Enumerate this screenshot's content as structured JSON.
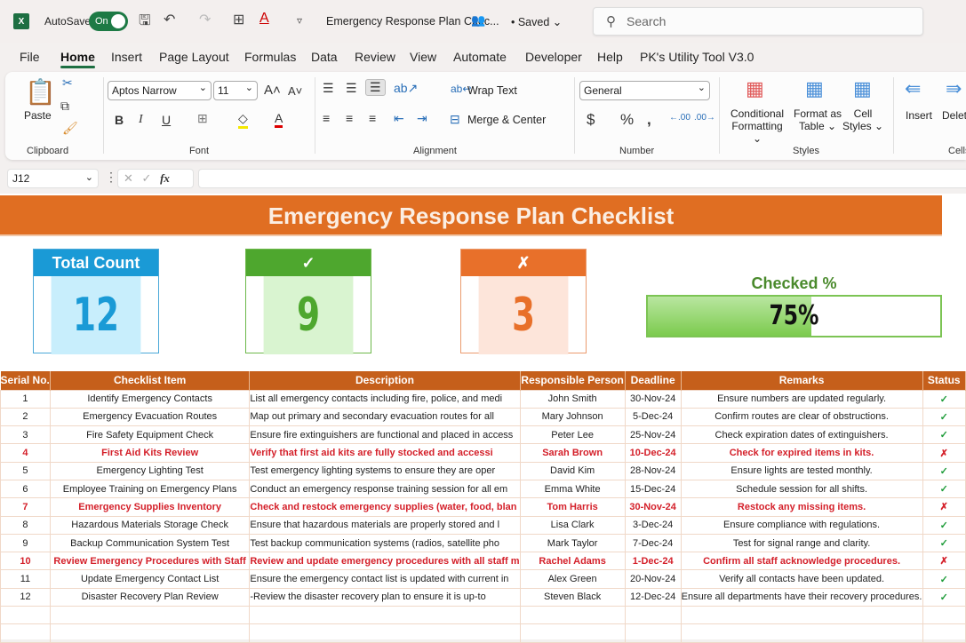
{
  "titlebar": {
    "autosave_label": "AutoSave",
    "autosave_state": "On",
    "doc_title": "Emergency Response Plan Chec...",
    "saved_status": "• Saved ⌄",
    "search_placeholder": "Search"
  },
  "tabs": [
    "File",
    "Home",
    "Insert",
    "Page Layout",
    "Formulas",
    "Data",
    "Review",
    "View",
    "Automate",
    "Developer",
    "Help",
    "PK's Utility Tool V3.0"
  ],
  "active_tab": "Home",
  "ribbon": {
    "clipboard": {
      "paste": "Paste",
      "label": "Clipboard"
    },
    "font": {
      "name": "Aptos Narrow",
      "size": "11",
      "label": "Font",
      "bold": "B",
      "italic": "I",
      "underline": "U"
    },
    "alignment": {
      "wrap_text": "Wrap Text",
      "merge_center": "Merge & Center",
      "label": "Alignment"
    },
    "number": {
      "format": "General",
      "label": "Number"
    },
    "styles": {
      "conditional": "Conditional",
      "conditional2": "Formatting ⌄",
      "format_as": "Format as",
      "format_as2": "Table ⌄",
      "cell": "Cell",
      "cell2": "Styles ⌄",
      "label": "Styles"
    },
    "cells": {
      "insert": "Insert",
      "delete": "Delete",
      "label": "Cells"
    }
  },
  "formula_bar": {
    "name_box": "J12",
    "fx": "fx",
    "value": ""
  },
  "sheet": {
    "title": "Emergency Response Plan Checklist",
    "cards": {
      "total": {
        "header": "Total Count",
        "value": "12",
        "color": "#1a9ad6"
      },
      "checked": {
        "header": "✓",
        "value": "9",
        "color": "#4ea72e"
      },
      "unchecked": {
        "header": "✗",
        "value": "3",
        "color": "#e8702a"
      }
    },
    "checked_pct": {
      "label": "Checked %",
      "value": 0.75,
      "text": "75%"
    },
    "columns": [
      "Serial No.",
      "Checklist Item",
      "Description",
      "Responsible Person",
      "Deadline",
      "Remarks",
      "Status"
    ],
    "rows": [
      {
        "no": "1",
        "item": "Identify Emergency Contacts",
        "desc": "List all emergency contacts including fire, police, and medi",
        "person": "John Smith",
        "deadline": "30-Nov-24",
        "remarks": "Ensure numbers are updated regularly.",
        "status": "✓",
        "flag": false
      },
      {
        "no": "2",
        "item": "Emergency Evacuation Routes",
        "desc": "Map out primary and secondary evacuation routes for all",
        "person": "Mary Johnson",
        "deadline": "5-Dec-24",
        "remarks": "Confirm routes are clear of obstructions.",
        "status": "✓",
        "flag": false
      },
      {
        "no": "3",
        "item": "Fire Safety Equipment Check",
        "desc": "Ensure fire extinguishers are functional and placed in access",
        "person": "Peter Lee",
        "deadline": "25-Nov-24",
        "remarks": "Check expiration dates of extinguishers.",
        "status": "✓",
        "flag": false
      },
      {
        "no": "4",
        "item": "First Aid Kits Review",
        "desc": "Verify that first aid kits are fully stocked and accessi",
        "person": "Sarah Brown",
        "deadline": "10-Dec-24",
        "remarks": "Check for expired items in kits.",
        "status": "✗",
        "flag": true
      },
      {
        "no": "5",
        "item": "Emergency Lighting Test",
        "desc": "Test emergency lighting systems to ensure they are oper",
        "person": "David Kim",
        "deadline": "28-Nov-24",
        "remarks": "Ensure lights are tested monthly.",
        "status": "✓",
        "flag": false
      },
      {
        "no": "6",
        "item": "Employee Training on Emergency Plans",
        "desc": "Conduct an emergency response training session for all em",
        "person": "Emma White",
        "deadline": "15-Dec-24",
        "remarks": "Schedule session for all shifts.",
        "status": "✓",
        "flag": false
      },
      {
        "no": "7",
        "item": "Emergency Supplies Inventory",
        "desc": "Check and restock emergency supplies (water, food, blan",
        "person": "Tom Harris",
        "deadline": "30-Nov-24",
        "remarks": "Restock any missing items.",
        "status": "✗",
        "flag": true
      },
      {
        "no": "8",
        "item": "Hazardous Materials Storage Check",
        "desc": "Ensure that hazardous materials are properly stored and l",
        "person": "Lisa Clark",
        "deadline": "3-Dec-24",
        "remarks": "Ensure compliance with regulations.",
        "status": "✓",
        "flag": false
      },
      {
        "no": "9",
        "item": "Backup Communication System Test",
        "desc": "Test backup communication systems (radios, satellite pho",
        "person": "Mark Taylor",
        "deadline": "7-Dec-24",
        "remarks": "Test for signal range and clarity.",
        "status": "✓",
        "flag": false
      },
      {
        "no": "10",
        "item": "Review Emergency Procedures with Staff",
        "desc": "Review and update emergency procedures with all staff m",
        "person": "Rachel Adams",
        "deadline": "1-Dec-24",
        "remarks": "Confirm all staff acknowledge procedures.",
        "status": "✗",
        "flag": true
      },
      {
        "no": "11",
        "item": "Update Emergency Contact List",
        "desc": "Ensure the emergency contact list is updated with current in",
        "person": "Alex Green",
        "deadline": "20-Nov-24",
        "remarks": "Verify all contacts have been updated.",
        "status": "✓",
        "flag": false
      },
      {
        "no": "12",
        "item": "Disaster Recovery Plan Review",
        "desc": "Review the disaster recovery plan to ensure it is up-to-",
        "person": "Steven Black",
        "deadline": "12-Dec-24",
        "remarks": "Ensure all departments have their recovery procedures.",
        "status": "✓",
        "flag": false
      }
    ]
  }
}
